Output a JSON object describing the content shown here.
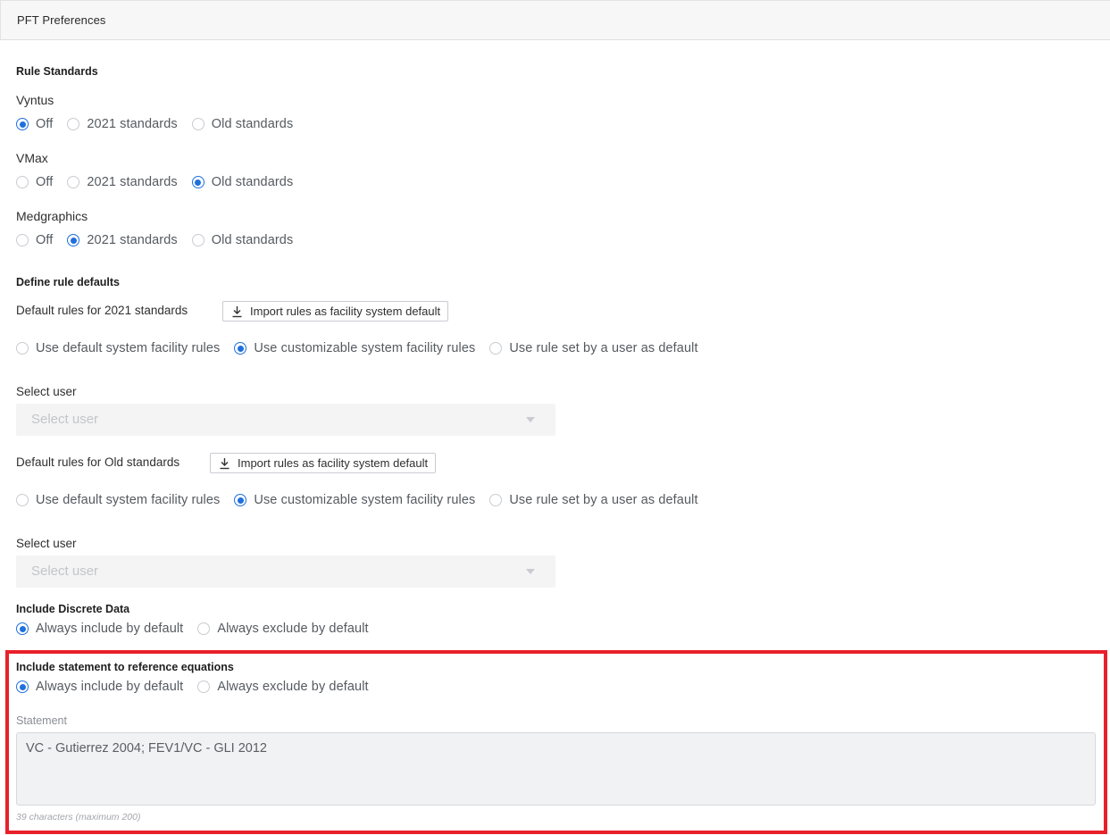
{
  "header": {
    "title": "PFT Preferences"
  },
  "rule_standards": {
    "title": "Rule Standards",
    "groups": [
      {
        "label": "Vyntus",
        "options": [
          "Off",
          "2021 standards",
          "Old standards"
        ],
        "selected": 0
      },
      {
        "label": "VMax",
        "options": [
          "Off",
          "2021 standards",
          "Old standards"
        ],
        "selected": 2
      },
      {
        "label": "Medgraphics",
        "options": [
          "Off",
          "2021 standards",
          "Old standards"
        ],
        "selected": 1
      }
    ]
  },
  "define_defaults": {
    "title": "Define rule defaults",
    "sections": [
      {
        "label": "Default rules for 2021 standards",
        "import_label": "Import rules as facility system default",
        "options": [
          "Use default system facility rules",
          "Use customizable system facility rules",
          "Use rule set by a user as default"
        ],
        "selected": 1,
        "select_user_label": "Select user",
        "select_user_placeholder": "Select user"
      },
      {
        "label": "Default rules for Old standards",
        "import_label": "Import rules as facility system default",
        "options": [
          "Use default system facility rules",
          "Use customizable system facility rules",
          "Use rule set by a user as default"
        ],
        "selected": 1,
        "select_user_label": "Select user",
        "select_user_placeholder": "Select user"
      }
    ]
  },
  "discrete_data": {
    "title": "Include Discrete Data",
    "options": [
      "Always include by default",
      "Always exclude by default"
    ],
    "selected": 0
  },
  "reference_statement": {
    "title": "Include statement to reference equations",
    "options": [
      "Always include by default",
      "Always exclude by default"
    ],
    "selected": 0,
    "statement_label": "Statement",
    "statement_value": "VC - Gutierrez 2004; FEV1/VC - GLI 2012",
    "char_count": "39 characters (maximum 200)"
  },
  "colors": {
    "accent": "#1f6fdc",
    "highlight": "#e8202a"
  }
}
